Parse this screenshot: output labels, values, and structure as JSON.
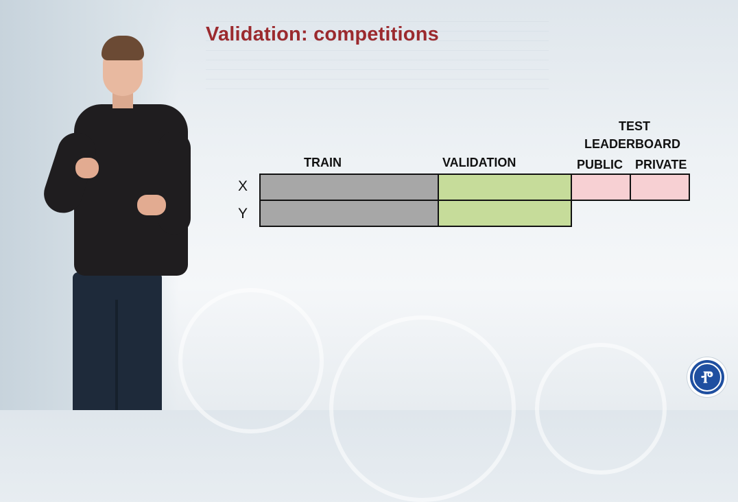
{
  "slide": {
    "title": "Validation: competitions"
  },
  "diagram": {
    "headers": {
      "train": "TRAIN",
      "validation": "VALIDATION",
      "test": "TEST",
      "leaderboard": "LEADERBOARD",
      "public": "PUBLIC",
      "private": "PRIVATE"
    },
    "rows": [
      "X",
      "Y"
    ],
    "colors": {
      "train": "#a7a7a7",
      "validation": "#c6dc9a",
      "test": "#f7d0d3",
      "title": "#9b2a2e",
      "logo": "#1f4fa0"
    }
  },
  "logo": {
    "icon": "university-emblem-icon"
  }
}
